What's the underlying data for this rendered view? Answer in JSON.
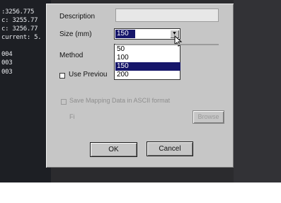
{
  "console": {
    "lines": [
      ":3256.775",
      "c: 3255.77",
      "c: 3256.77",
      "current: 5.",
      "004",
      "003",
      "003"
    ]
  },
  "dialog": {
    "description_label": "Description",
    "size_label": "Size (mm)",
    "size_selected": "150",
    "size_options": [
      "50",
      "100",
      "150",
      "200"
    ],
    "method_label": "Method",
    "use_previous_label": "Use Previou",
    "save_mapping_label": "Save Mapping Data in ASCII format",
    "file_label": "Fi",
    "browse_label": "Browse",
    "ok_label": "OK",
    "cancel_label": "Cancel"
  },
  "colors": {
    "dialog_bg": "#c6c6c6",
    "selection": "#16166a",
    "console_bg": "#1d1f24"
  }
}
